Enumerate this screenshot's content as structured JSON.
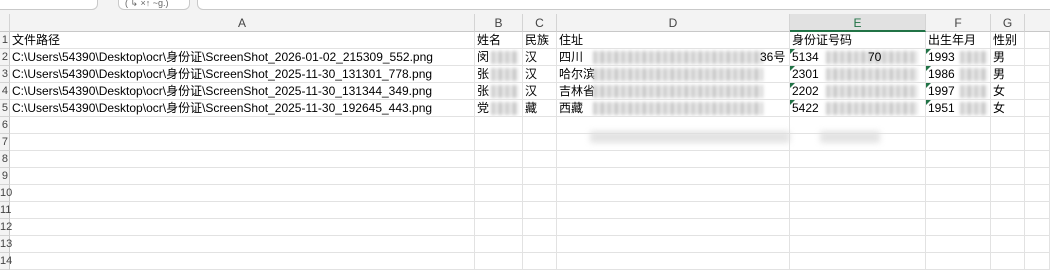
{
  "toolbar": {
    "zoom_label": "( ↳ ×↑ ~g.)"
  },
  "columns": [
    "A",
    "B",
    "C",
    "D",
    "E",
    "F",
    "G"
  ],
  "selected_column": "E",
  "row_numbers": [
    "1",
    "2",
    "3",
    "4",
    "5",
    "6",
    "7",
    "8",
    "9",
    "10",
    "11",
    "12",
    "13",
    "14"
  ],
  "headers": {
    "path": "文件路径",
    "name": "姓名",
    "ethnicity": "民族",
    "address": "住址",
    "id_number": "身份证号码",
    "birth": "出生年月",
    "gender": "性别"
  },
  "rows": [
    {
      "path": "C:\\Users\\54390\\Desktop\\ocr\\身份证\\ScreenShot_2026-01-02_215309_552.png",
      "name": "闵",
      "ethnicity": "汉",
      "address": "四川",
      "address_tail": "36号",
      "id_number": "5134",
      "id_tail": "70",
      "birth": "1993",
      "gender": "男"
    },
    {
      "path": "C:\\Users\\54390\\Desktop\\ocr\\身份证\\ScreenShot_2025-11-30_131301_778.png",
      "name": "张",
      "ethnicity": "汉",
      "address": "哈尔滨",
      "address_tail": "",
      "id_number": "2301",
      "id_tail": "",
      "birth": "1986",
      "gender": "男"
    },
    {
      "path": "C:\\Users\\54390\\Desktop\\ocr\\身份证\\ScreenShot_2025-11-30_131344_349.png",
      "name": "张",
      "ethnicity": "汉",
      "address": "吉林省",
      "address_tail": "",
      "id_number": "2202",
      "id_tail": "",
      "birth": "1997",
      "gender": "女"
    },
    {
      "path": "C:\\Users\\54390\\Desktop\\ocr\\身份证\\ScreenShot_2025-11-30_192645_443.png",
      "name": "党",
      "ethnicity": "藏",
      "address": "西藏",
      "address_tail": "",
      "id_number": "5422",
      "id_tail": "",
      "birth": "1951",
      "gender": "女"
    }
  ]
}
